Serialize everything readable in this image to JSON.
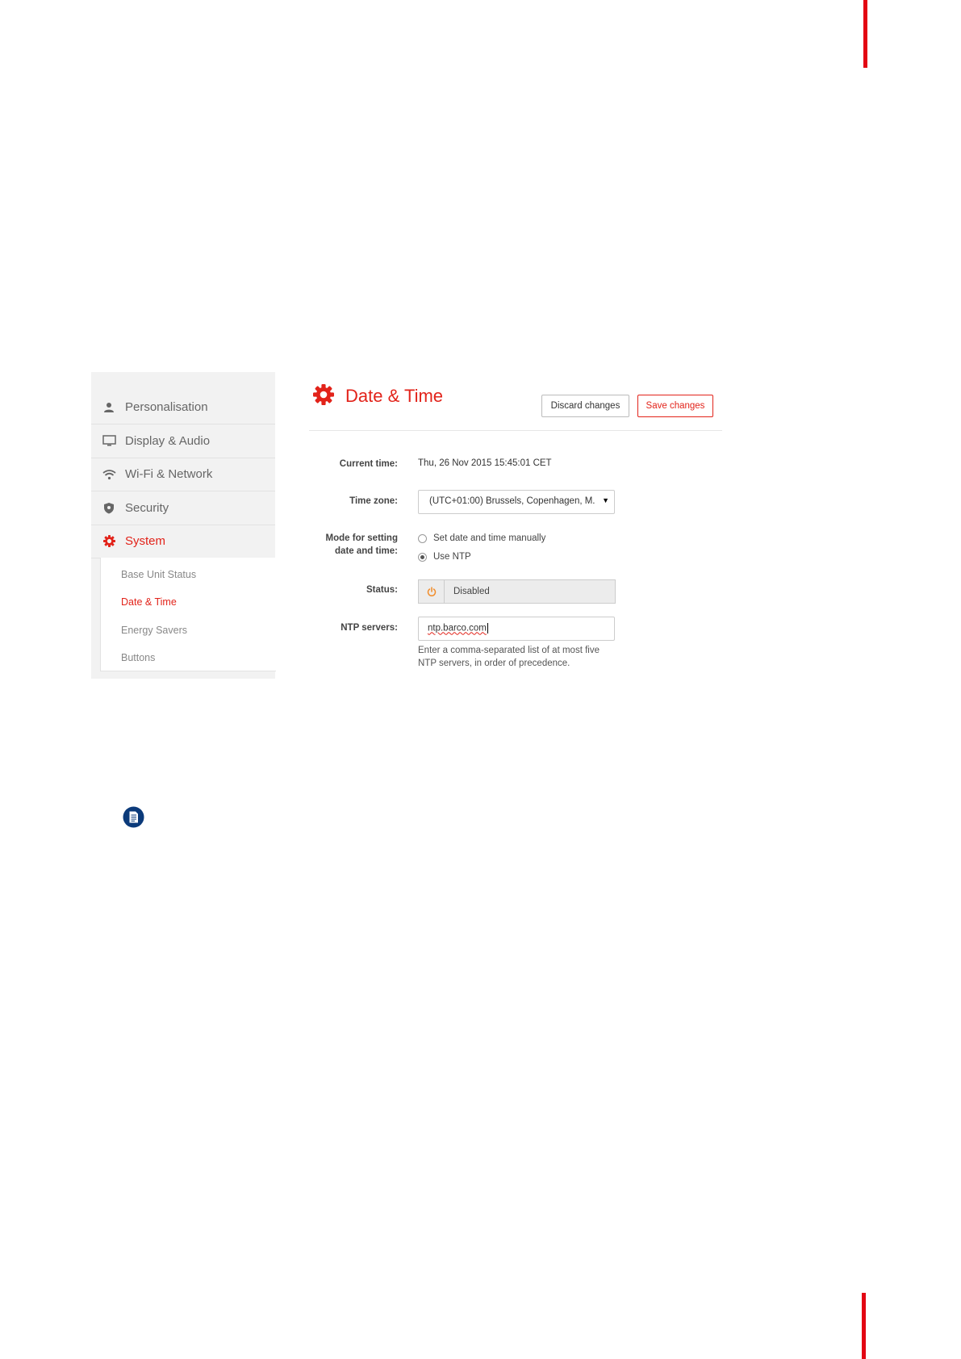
{
  "colors": {
    "brand": "#e2231a",
    "accent_bar": "#e30613",
    "note_icon": "#0b3a7a",
    "status_icon": "#f28c28"
  },
  "sidebar": {
    "items": [
      {
        "label": "Personalisation",
        "icon": "user-icon"
      },
      {
        "label": "Display & Audio",
        "icon": "monitor-icon"
      },
      {
        "label": "Wi-Fi & Network",
        "icon": "wifi-icon"
      },
      {
        "label": "Security",
        "icon": "shield-icon"
      },
      {
        "label": "System",
        "icon": "gear-icon",
        "active": true
      }
    ],
    "subitems": [
      {
        "label": "Base Unit Status"
      },
      {
        "label": "Date & Time",
        "active": true
      },
      {
        "label": "Energy Savers"
      },
      {
        "label": "Buttons"
      }
    ]
  },
  "header": {
    "title": "Date & Time",
    "icon": "gear-icon",
    "discard_label": "Discard changes",
    "save_label": "Save changes"
  },
  "form": {
    "current_time": {
      "label": "Current time:",
      "value": "Thu, 26 Nov 2015 15:45:01 CET"
    },
    "time_zone": {
      "label": "Time zone:",
      "value": "(UTC+01:00) Brussels, Copenhagen, M."
    },
    "mode": {
      "label_line1": "Mode for setting",
      "label_line2": "date and time:",
      "options": [
        {
          "label": "Set date and time manually",
          "checked": false
        },
        {
          "label": "Use NTP",
          "checked": true
        }
      ]
    },
    "status": {
      "label": "Status:",
      "value": "Disabled",
      "icon": "power-icon"
    },
    "ntp_servers": {
      "label": "NTP servers:",
      "value": "ntp.barco.com",
      "help_line1": "Enter a comma-separated list of at most five",
      "help_line2": "NTP servers, in order of precedence."
    }
  },
  "note": {
    "icon": "note-icon"
  }
}
